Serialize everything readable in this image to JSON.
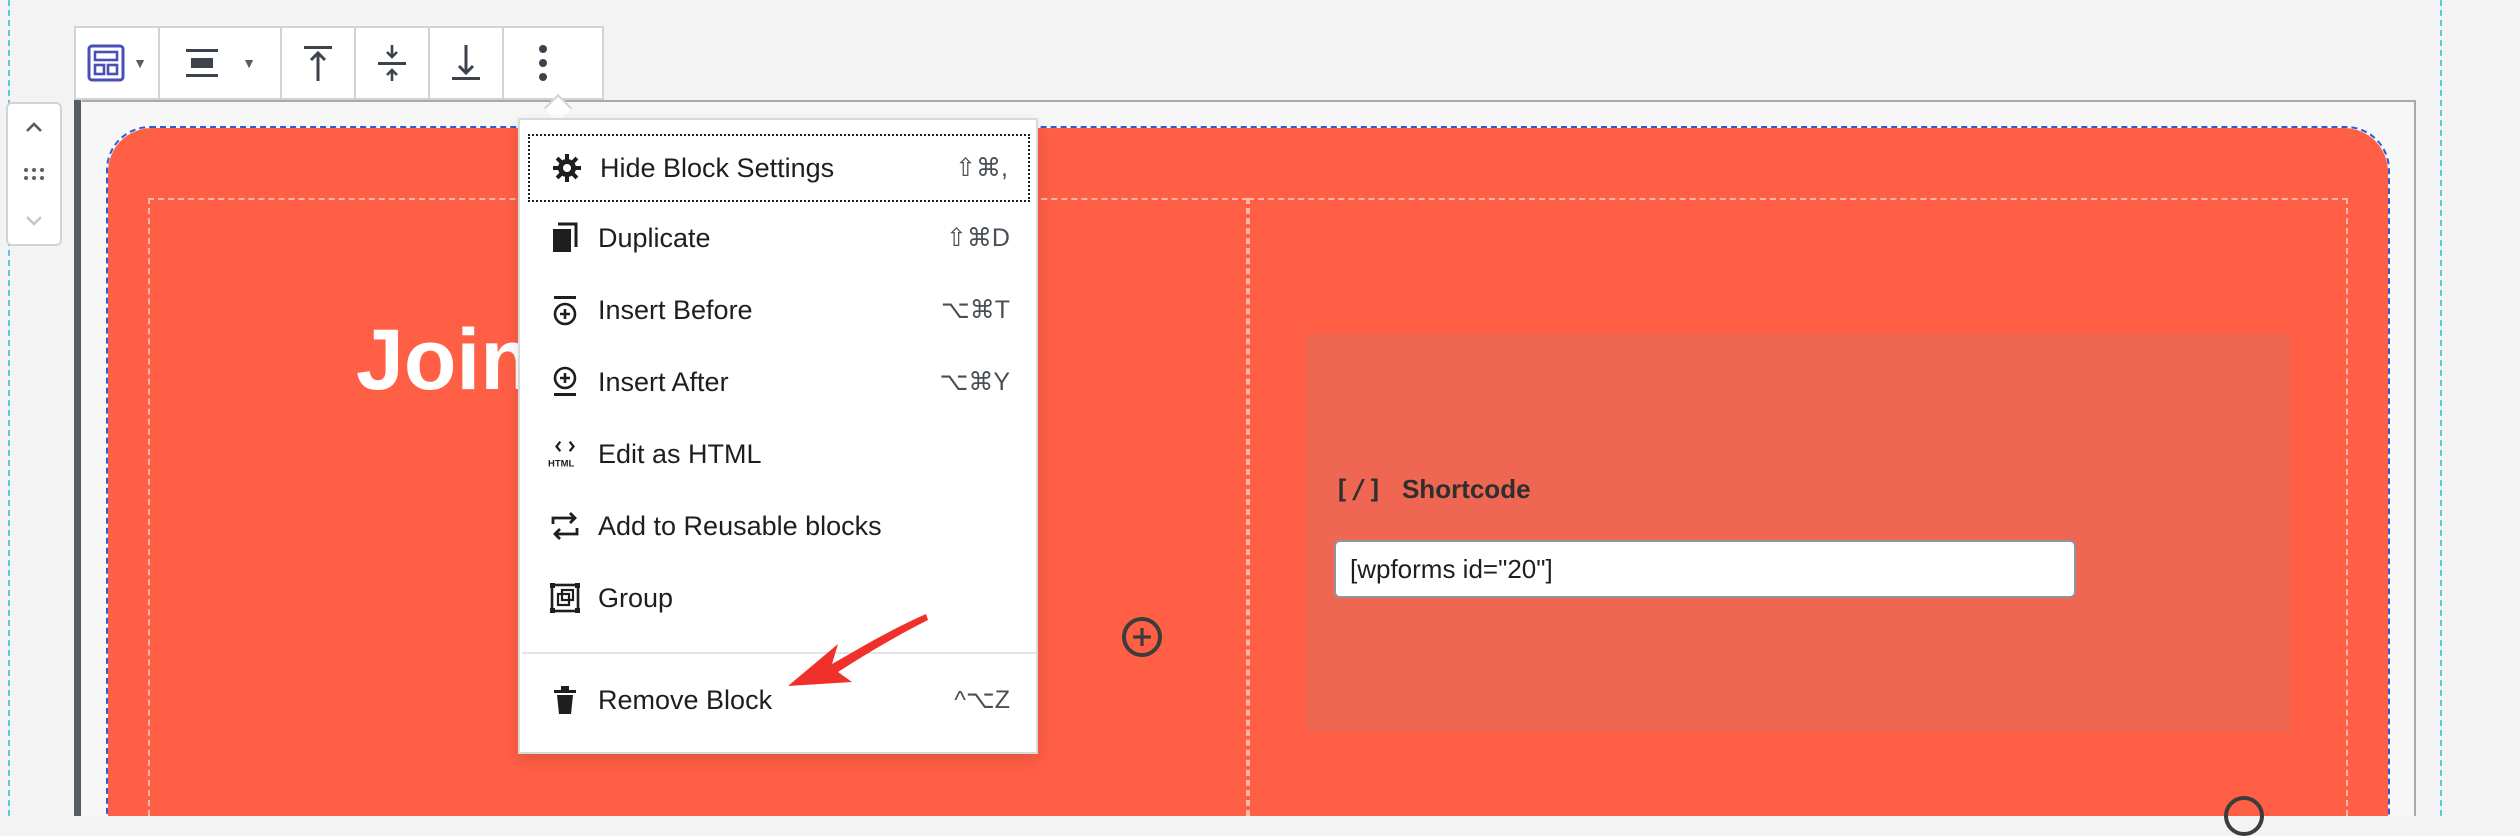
{
  "toolbar": {
    "buttons": [
      "block-type",
      "align",
      "align-top",
      "align-middle",
      "align-bottom",
      "more-options"
    ]
  },
  "cover": {
    "heading": "Join"
  },
  "shortcode": {
    "label": "Shortcode",
    "bracket_icon": "[/]",
    "value": "[wpforms id=\"20\"]"
  },
  "menu": {
    "items": [
      {
        "label": "Hide Block Settings",
        "shortcut": "⇧⌘,",
        "icon": "gear-icon"
      },
      {
        "label": "Duplicate",
        "shortcut": "⇧⌘D",
        "icon": "duplicate-icon"
      },
      {
        "label": "Insert Before",
        "shortcut": "⌥⌘T",
        "icon": "insert-before-icon"
      },
      {
        "label": "Insert After",
        "shortcut": "⌥⌘Y",
        "icon": "insert-after-icon"
      },
      {
        "label": "Edit as HTML",
        "shortcut": "",
        "icon": "html-icon"
      },
      {
        "label": "Add to Reusable blocks",
        "shortcut": "",
        "icon": "reusable-icon"
      },
      {
        "label": "Group",
        "shortcut": "",
        "icon": "group-icon"
      }
    ],
    "remove": {
      "label": "Remove Block",
      "shortcut": "^⌥Z",
      "icon": "trash-icon"
    }
  },
  "colors": {
    "cover_bg": "#ff5f45",
    "panel_bg": "#ef6652",
    "accent": "#4a4fb8",
    "arrow": "#f0302a"
  }
}
